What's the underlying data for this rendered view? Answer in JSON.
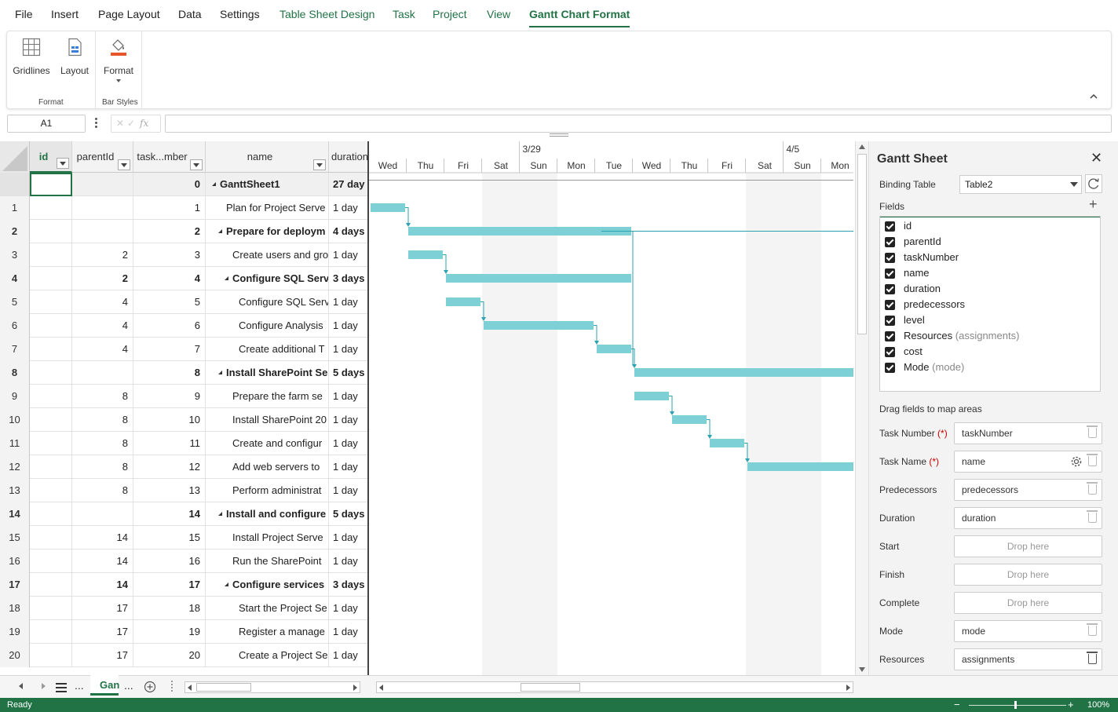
{
  "menu": {
    "items": [
      "File",
      "Insert",
      "Page Layout",
      "Data",
      "Settings",
      "Table Sheet Design",
      "Task",
      "Project",
      "View",
      "Gantt Chart Format"
    ]
  },
  "ribbon": {
    "gridlines": "Gridlines",
    "layout": "Layout",
    "format": "Format",
    "group_format": "Format",
    "group_bar_styles": "Bar Styles"
  },
  "formula_bar": {
    "cell_ref": "A1",
    "fx": "fx",
    "value": ""
  },
  "table": {
    "headers": [
      "id",
      "parentId",
      "task...mber",
      "name",
      "duration"
    ],
    "rows": [
      {
        "rh": "",
        "id": "",
        "parent": "",
        "task": "0",
        "name": "GanttSheet1",
        "dur": "27 day",
        "bold": true,
        "tri": true,
        "indent": 0
      },
      {
        "rh": "1",
        "id": "",
        "parent": "",
        "task": "1",
        "name": "Plan for Project Serve",
        "dur": "1 day",
        "bold": false,
        "tri": false,
        "indent": 1
      },
      {
        "rh": "2",
        "id": "",
        "parent": "",
        "task": "2",
        "name": "Prepare for deploym",
        "dur": "4 days",
        "bold": true,
        "tri": true,
        "indent": 1
      },
      {
        "rh": "3",
        "id": "",
        "parent": "2",
        "task": "3",
        "name": "Create users and gro",
        "dur": "1 day",
        "bold": false,
        "tri": false,
        "indent": 2
      },
      {
        "rh": "4",
        "id": "",
        "parent": "2",
        "task": "4",
        "name": "Configure SQL Serve",
        "dur": "3 days",
        "bold": true,
        "tri": true,
        "indent": 2
      },
      {
        "rh": "5",
        "id": "",
        "parent": "4",
        "task": "5",
        "name": "Configure SQL Serv",
        "dur": "1 day",
        "bold": false,
        "tri": false,
        "indent": 3
      },
      {
        "rh": "6",
        "id": "",
        "parent": "4",
        "task": "6",
        "name": "Configure Analysis",
        "dur": "1 day",
        "bold": false,
        "tri": false,
        "indent": 3
      },
      {
        "rh": "7",
        "id": "",
        "parent": "4",
        "task": "7",
        "name": "Create additional T",
        "dur": "1 day",
        "bold": false,
        "tri": false,
        "indent": 3
      },
      {
        "rh": "8",
        "id": "",
        "parent": "",
        "task": "8",
        "name": "Install SharePoint Ser",
        "dur": "5 days",
        "bold": true,
        "tri": true,
        "indent": 1
      },
      {
        "rh": "9",
        "id": "",
        "parent": "8",
        "task": "9",
        "name": "Prepare the farm se",
        "dur": "1 day",
        "bold": false,
        "tri": false,
        "indent": 2
      },
      {
        "rh": "10",
        "id": "",
        "parent": "8",
        "task": "10",
        "name": "Install SharePoint 20",
        "dur": "1 day",
        "bold": false,
        "tri": false,
        "indent": 2
      },
      {
        "rh": "11",
        "id": "",
        "parent": "8",
        "task": "11",
        "name": "Create and configur",
        "dur": "1 day",
        "bold": false,
        "tri": false,
        "indent": 2
      },
      {
        "rh": "12",
        "id": "",
        "parent": "8",
        "task": "12",
        "name": "Add web servers to",
        "dur": "1 day",
        "bold": false,
        "tri": false,
        "indent": 2
      },
      {
        "rh": "13",
        "id": "",
        "parent": "8",
        "task": "13",
        "name": "Perform administrat",
        "dur": "1 day",
        "bold": false,
        "tri": false,
        "indent": 2
      },
      {
        "rh": "14",
        "id": "",
        "parent": "",
        "task": "14",
        "name": "Install and configure",
        "dur": "5 days",
        "bold": true,
        "tri": true,
        "indent": 1
      },
      {
        "rh": "15",
        "id": "",
        "parent": "14",
        "task": "15",
        "name": "Install Project Serve",
        "dur": "1 day",
        "bold": false,
        "tri": false,
        "indent": 2
      },
      {
        "rh": "16",
        "id": "",
        "parent": "14",
        "task": "16",
        "name": "Run the SharePoint",
        "dur": "1 day",
        "bold": false,
        "tri": false,
        "indent": 2
      },
      {
        "rh": "17",
        "id": "",
        "parent": "14",
        "task": "17",
        "name": "Configure services",
        "dur": "3 days",
        "bold": true,
        "tri": true,
        "indent": 2
      },
      {
        "rh": "18",
        "id": "",
        "parent": "17",
        "task": "18",
        "name": "Start the Project Se",
        "dur": "1 day",
        "bold": false,
        "tri": false,
        "indent": 3
      },
      {
        "rh": "19",
        "id": "",
        "parent": "17",
        "task": "19",
        "name": "Register a manage",
        "dur": "1 day",
        "bold": false,
        "tri": false,
        "indent": 3
      },
      {
        "rh": "20",
        "id": "",
        "parent": "17",
        "task": "20",
        "name": "Create a Project Se",
        "dur": "1 day",
        "bold": false,
        "tri": false,
        "indent": 3
      }
    ]
  },
  "gantt": {
    "week_labels": [
      "3/29",
      "4/5"
    ],
    "days": [
      "Wed",
      "Thu",
      "Fri",
      "Sat",
      "Sun",
      "Mon",
      "Tue",
      "Wed",
      "Thu",
      "Fri",
      "Sat",
      "Sun",
      "Mon"
    ],
    "bar_color": "#7dd0d6",
    "link_color": "#2aa3ad",
    "bars": [
      {
        "row": 1,
        "start": 0,
        "len": 1
      },
      {
        "row": 2,
        "start": 1,
        "len": 6
      },
      {
        "row": 3,
        "start": 1,
        "len": 1
      },
      {
        "row": 4,
        "start": 2,
        "len": 5
      },
      {
        "row": 5,
        "start": 2,
        "len": 1
      },
      {
        "row": 6,
        "start": 3,
        "len": 3
      },
      {
        "row": 7,
        "start": 6,
        "len": 1
      },
      {
        "row": 8,
        "start": 7,
        "len": 6
      },
      {
        "row": 9,
        "start": 7,
        "len": 1
      },
      {
        "row": 10,
        "start": 8,
        "len": 1
      },
      {
        "row": 11,
        "start": 9,
        "len": 1
      },
      {
        "row": 12,
        "start": 10,
        "len": 3
      }
    ]
  },
  "sheet_tabs": {
    "active": "Gan",
    "more": "..."
  },
  "status": {
    "text": "Ready",
    "zoom": "100%"
  },
  "panel": {
    "title": "Gantt Sheet",
    "binding_label": "Binding Table",
    "binding_value": "Table2",
    "fields_label": "Fields",
    "fields": [
      {
        "name": "id",
        "sub": ""
      },
      {
        "name": "parentId",
        "sub": ""
      },
      {
        "name": "taskNumber",
        "sub": ""
      },
      {
        "name": "name",
        "sub": ""
      },
      {
        "name": "duration",
        "sub": ""
      },
      {
        "name": "predecessors",
        "sub": ""
      },
      {
        "name": "level",
        "sub": ""
      },
      {
        "name": "Resources",
        "sub": "(assignments)"
      },
      {
        "name": "cost",
        "sub": ""
      },
      {
        "name": "Mode",
        "sub": "(mode)"
      }
    ],
    "drag_label": "Drag fields to map areas",
    "mappings": [
      {
        "label": "Task Number",
        "req": "(*)",
        "value": "taskNumber",
        "drop": false
      },
      {
        "label": "Task Name",
        "req": "(*)",
        "value": "name",
        "drop": false
      },
      {
        "label": "Predecessors",
        "req": "",
        "value": "predecessors",
        "drop": false
      },
      {
        "label": "Duration",
        "req": "",
        "value": "duration",
        "drop": false
      },
      {
        "label": "Start",
        "req": "",
        "value": "Drop here",
        "drop": true
      },
      {
        "label": "Finish",
        "req": "",
        "value": "Drop here",
        "drop": true
      },
      {
        "label": "Complete",
        "req": "",
        "value": "Drop here",
        "drop": true
      },
      {
        "label": "Mode",
        "req": "",
        "value": "mode",
        "drop": false
      },
      {
        "label": "Resources",
        "req": "",
        "value": "assignments",
        "drop": false
      }
    ]
  }
}
